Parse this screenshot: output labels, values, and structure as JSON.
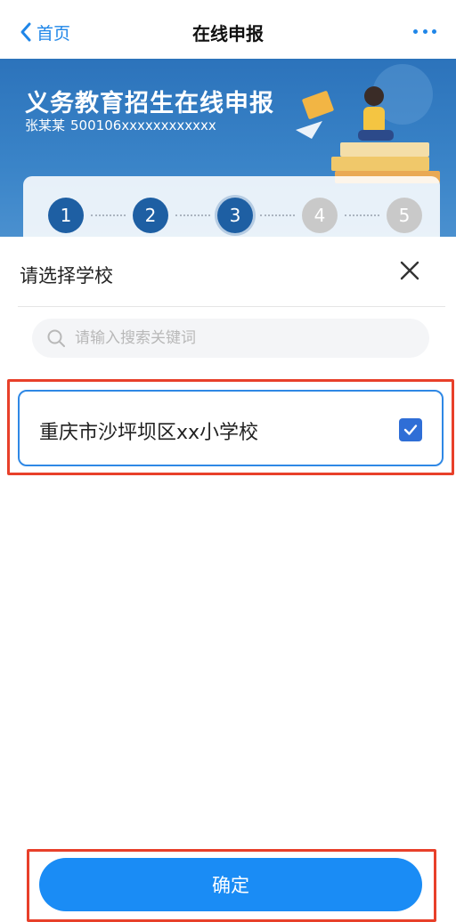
{
  "nav": {
    "back_label": "首页",
    "title": "在线申报"
  },
  "banner": {
    "title": "义务教育招生在线申报",
    "user_name": "张某某",
    "user_id": "500106xxxxxxxxxxxx",
    "steps": [
      "1",
      "2",
      "3",
      "4",
      "5"
    ],
    "current_step": 3
  },
  "sheet": {
    "title": "请选择学校",
    "search": {
      "placeholder": "请输入搜索关键词",
      "value": ""
    },
    "schools": [
      {
        "name": "重庆市沙坪坝区xx小学校",
        "selected": true
      }
    ],
    "confirm_label": "确定"
  },
  "colors": {
    "accent": "#1a8cf5",
    "highlight": "#e8402a",
    "banner": "#2c73bb"
  }
}
